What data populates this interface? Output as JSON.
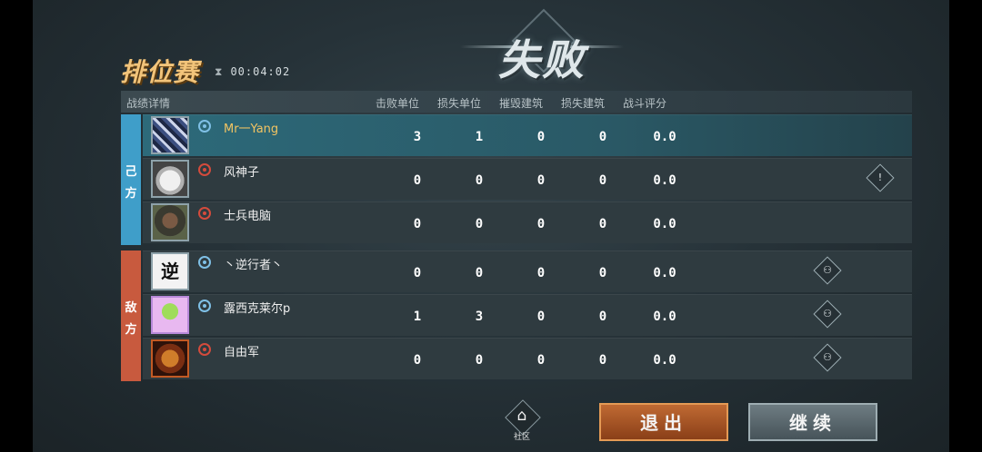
{
  "title": {
    "result": "失败",
    "mode": "排位赛",
    "timer": "00:04:02"
  },
  "headers": {
    "details": "战绩详情",
    "kills": "击败单位",
    "lost_units": "损失单位",
    "destroyed_buildings": "摧毁建筑",
    "lost_buildings": "损失建筑",
    "score": "战斗评分"
  },
  "sides": {
    "own_top": "己",
    "own_bottom": "方",
    "enemy_top": "敌",
    "enemy_bottom": "方"
  },
  "players": [
    {
      "name": "Mr一Yang",
      "avatar": "pixel-avatar",
      "faction": "blue-faction-icon",
      "kills": "3",
      "lost_units": "1",
      "destroyed_buildings": "0",
      "lost_buildings": "0",
      "score": "0.0",
      "action": null
    },
    {
      "name": "风神子",
      "avatar": "helmet-avatar",
      "faction": "red-faction-icon",
      "kills": "0",
      "lost_units": "0",
      "destroyed_buildings": "0",
      "lost_buildings": "0",
      "score": "0.0",
      "action": "report-icon"
    },
    {
      "name": "士兵电脑",
      "avatar": "soldier-avatar",
      "faction": "red-faction-icon",
      "kills": "0",
      "lost_units": "0",
      "destroyed_buildings": "0",
      "lost_buildings": "0",
      "score": "0.0",
      "action": null
    },
    {
      "name": "丶逆行者丶",
      "avatar": "calligraphy-avatar",
      "avatar_text": "逆",
      "faction": "blue-faction-icon",
      "kills": "0",
      "lost_units": "0",
      "destroyed_buildings": "0",
      "lost_buildings": "0",
      "score": "0.0",
      "action": "add-friend-icon"
    },
    {
      "name": "露西克莱尔p",
      "avatar": "plant-avatar",
      "faction": "blue-faction-icon",
      "kills": "1",
      "lost_units": "3",
      "destroyed_buildings": "0",
      "lost_buildings": "0",
      "score": "0.0",
      "action": "add-friend-icon"
    },
    {
      "name": "自由军",
      "avatar": "tiger-avatar",
      "faction": "red-faction-icon",
      "kills": "0",
      "lost_units": "0",
      "destroyed_buildings": "0",
      "lost_buildings": "0",
      "score": "0.0",
      "action": "add-friend-icon"
    }
  ],
  "bottom": {
    "community_label": "社区",
    "exit_label": "退出",
    "continue_label": "继续"
  },
  "colors": {
    "own_side": "#3f9ec9",
    "enemy_side": "#c85a3e",
    "highlight_name": "#f2c462",
    "mode_title": "#f2c47a"
  }
}
